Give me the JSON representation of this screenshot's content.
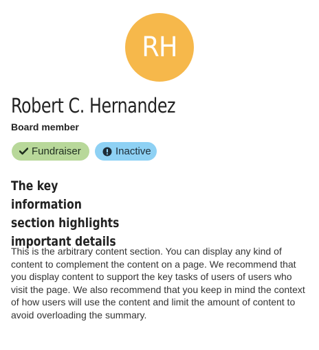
{
  "profile": {
    "avatar": {
      "initials": "RH",
      "color": "#f6b84b"
    },
    "name": "Robert C. Hernandez",
    "role": "Board member",
    "badges": [
      {
        "label": "Fundraiser",
        "icon": "check-icon",
        "color": "#b8d89a"
      },
      {
        "label": "Inactive",
        "icon": "exclamation-circle-icon",
        "color": "#8ed1f4"
      }
    ],
    "key_info_heading": {
      "line1": "The key information",
      "line2": "section highlights",
      "line3": "important details"
    },
    "content": "This is the arbitrary content section. You can display any kind of content to complement the content on a page. We recommend that you display content to support the key tasks of users of users who visit the page. We also recommend that you keep in mind the context of how users will use the content and limit the amount of content to avoid overloading the summary."
  }
}
